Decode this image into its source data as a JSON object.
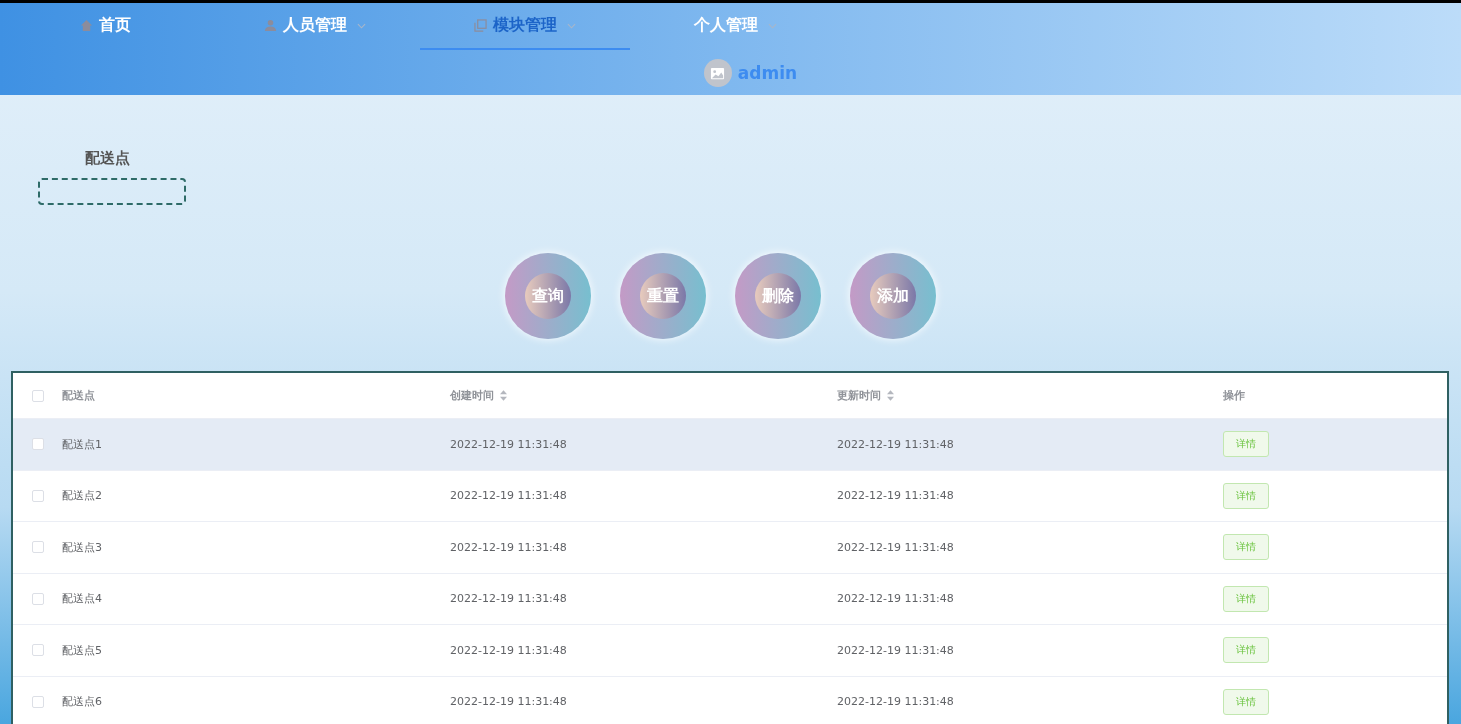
{
  "nav": [
    {
      "label": "首页",
      "dropdown": false,
      "selected": false
    },
    {
      "label": "人员管理",
      "dropdown": true,
      "selected": false
    },
    {
      "label": "模块管理",
      "dropdown": true,
      "selected": true
    },
    {
      "label": "个人管理",
      "dropdown": true,
      "selected": false
    }
  ],
  "user": {
    "name": "admin"
  },
  "search": {
    "label": "配送点"
  },
  "buttons": [
    "查询",
    "重置",
    "删除",
    "添加"
  ],
  "table": {
    "all_checked": false,
    "columns": [
      {
        "label": "配送点",
        "sortable": false
      },
      {
        "label": "创建时间",
        "sortable": true
      },
      {
        "label": "更新时间",
        "sortable": true
      },
      {
        "label": "操作",
        "sortable": false
      }
    ],
    "rows": [
      {
        "name": "配送点1",
        "created": "2022-12-19 11:31:48",
        "updated": "2022-12-19 11:31:48",
        "action": "详情",
        "checked": false,
        "hovered": true
      },
      {
        "name": "配送点2",
        "created": "2022-12-19 11:31:48",
        "updated": "2022-12-19 11:31:48",
        "action": "详情",
        "checked": false,
        "hovered": false
      },
      {
        "name": "配送点3",
        "created": "2022-12-19 11:31:48",
        "updated": "2022-12-19 11:31:48",
        "action": "详情",
        "checked": false,
        "hovered": false
      },
      {
        "name": "配送点4",
        "created": "2022-12-19 11:31:48",
        "updated": "2022-12-19 11:31:48",
        "action": "详情",
        "checked": false,
        "hovered": false
      },
      {
        "name": "配送点5",
        "created": "2022-12-19 11:31:48",
        "updated": "2022-12-19 11:31:48",
        "action": "详情",
        "checked": false,
        "hovered": false
      },
      {
        "name": "配送点6",
        "created": "2022-12-19 11:31:48",
        "updated": "2022-12-19 11:31:48",
        "action": "详情",
        "checked": false,
        "hovered": false
      }
    ]
  }
}
